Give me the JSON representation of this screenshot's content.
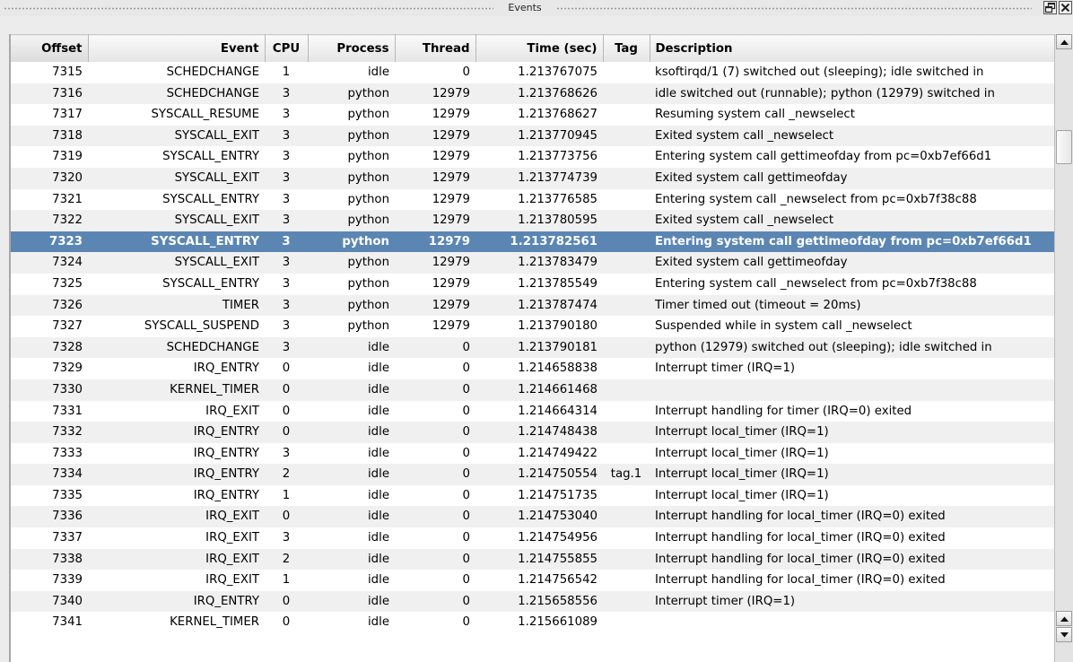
{
  "window": {
    "title": "Events"
  },
  "columns": [
    "Offset",
    "Event",
    "CPU",
    "Process",
    "Thread",
    "Time (sec)",
    "Tag",
    "Description"
  ],
  "selected_offset": "7323",
  "rows": [
    {
      "offset": "7315",
      "event": "SCHEDCHANGE",
      "cpu": "1",
      "process": "idle",
      "thread": "0",
      "time": "1.213767075",
      "tag": "",
      "desc": "ksoftirqd/1 (7) switched out (sleeping); idle switched in"
    },
    {
      "offset": "7316",
      "event": "SCHEDCHANGE",
      "cpu": "3",
      "process": "python",
      "thread": "12979",
      "time": "1.213768626",
      "tag": "",
      "desc": "idle switched out (runnable); python (12979) switched in"
    },
    {
      "offset": "7317",
      "event": "SYSCALL_RESUME",
      "cpu": "3",
      "process": "python",
      "thread": "12979",
      "time": "1.213768627",
      "tag": "",
      "desc": "Resuming system call _newselect"
    },
    {
      "offset": "7318",
      "event": "SYSCALL_EXIT",
      "cpu": "3",
      "process": "python",
      "thread": "12979",
      "time": "1.213770945",
      "tag": "",
      "desc": "Exited system call _newselect"
    },
    {
      "offset": "7319",
      "event": "SYSCALL_ENTRY",
      "cpu": "3",
      "process": "python",
      "thread": "12979",
      "time": "1.213773756",
      "tag": "",
      "desc": "Entering system call gettimeofday from pc=0xb7ef66d1"
    },
    {
      "offset": "7320",
      "event": "SYSCALL_EXIT",
      "cpu": "3",
      "process": "python",
      "thread": "12979",
      "time": "1.213774739",
      "tag": "",
      "desc": "Exited system call gettimeofday"
    },
    {
      "offset": "7321",
      "event": "SYSCALL_ENTRY",
      "cpu": "3",
      "process": "python",
      "thread": "12979",
      "time": "1.213776585",
      "tag": "",
      "desc": "Entering system call _newselect from pc=0xb7f38c88"
    },
    {
      "offset": "7322",
      "event": "SYSCALL_EXIT",
      "cpu": "3",
      "process": "python",
      "thread": "12979",
      "time": "1.213780595",
      "tag": "",
      "desc": "Exited system call _newselect"
    },
    {
      "offset": "7323",
      "event": "SYSCALL_ENTRY",
      "cpu": "3",
      "process": "python",
      "thread": "12979",
      "time": "1.213782561",
      "tag": "",
      "desc": "Entering system call gettimeofday from pc=0xb7ef66d1"
    },
    {
      "offset": "7324",
      "event": "SYSCALL_EXIT",
      "cpu": "3",
      "process": "python",
      "thread": "12979",
      "time": "1.213783479",
      "tag": "",
      "desc": "Exited system call gettimeofday"
    },
    {
      "offset": "7325",
      "event": "SYSCALL_ENTRY",
      "cpu": "3",
      "process": "python",
      "thread": "12979",
      "time": "1.213785549",
      "tag": "",
      "desc": "Entering system call _newselect from pc=0xb7f38c88"
    },
    {
      "offset": "7326",
      "event": "TIMER",
      "cpu": "3",
      "process": "python",
      "thread": "12979",
      "time": "1.213787474",
      "tag": "",
      "desc": "Timer timed out (timeout = 20ms)"
    },
    {
      "offset": "7327",
      "event": "SYSCALL_SUSPEND",
      "cpu": "3",
      "process": "python",
      "thread": "12979",
      "time": "1.213790180",
      "tag": "",
      "desc": "Suspended while in system call _newselect"
    },
    {
      "offset": "7328",
      "event": "SCHEDCHANGE",
      "cpu": "3",
      "process": "idle",
      "thread": "0",
      "time": "1.213790181",
      "tag": "",
      "desc": "python (12979) switched out (sleeping); idle switched in"
    },
    {
      "offset": "7329",
      "event": "IRQ_ENTRY",
      "cpu": "0",
      "process": "idle",
      "thread": "0",
      "time": "1.214658838",
      "tag": "",
      "desc": "Interrupt timer (IRQ=1)"
    },
    {
      "offset": "7330",
      "event": "KERNEL_TIMER",
      "cpu": "0",
      "process": "idle",
      "thread": "0",
      "time": "1.214661468",
      "tag": "",
      "desc": ""
    },
    {
      "offset": "7331",
      "event": "IRQ_EXIT",
      "cpu": "0",
      "process": "idle",
      "thread": "0",
      "time": "1.214664314",
      "tag": "",
      "desc": "Interrupt handling for timer (IRQ=0) exited"
    },
    {
      "offset": "7332",
      "event": "IRQ_ENTRY",
      "cpu": "0",
      "process": "idle",
      "thread": "0",
      "time": "1.214748438",
      "tag": "",
      "desc": "Interrupt local_timer (IRQ=1)"
    },
    {
      "offset": "7333",
      "event": "IRQ_ENTRY",
      "cpu": "3",
      "process": "idle",
      "thread": "0",
      "time": "1.214749422",
      "tag": "",
      "desc": "Interrupt local_timer (IRQ=1)"
    },
    {
      "offset": "7334",
      "event": "IRQ_ENTRY",
      "cpu": "2",
      "process": "idle",
      "thread": "0",
      "time": "1.214750554",
      "tag": "tag.1",
      "desc": "Interrupt local_timer (IRQ=1)"
    },
    {
      "offset": "7335",
      "event": "IRQ_ENTRY",
      "cpu": "1",
      "process": "idle",
      "thread": "0",
      "time": "1.214751735",
      "tag": "",
      "desc": "Interrupt local_timer (IRQ=1)"
    },
    {
      "offset": "7336",
      "event": "IRQ_EXIT",
      "cpu": "0",
      "process": "idle",
      "thread": "0",
      "time": "1.214753040",
      "tag": "",
      "desc": "Interrupt handling for local_timer (IRQ=0) exited"
    },
    {
      "offset": "7337",
      "event": "IRQ_EXIT",
      "cpu": "3",
      "process": "idle",
      "thread": "0",
      "time": "1.214754956",
      "tag": "",
      "desc": "Interrupt handling for local_timer (IRQ=0) exited"
    },
    {
      "offset": "7338",
      "event": "IRQ_EXIT",
      "cpu": "2",
      "process": "idle",
      "thread": "0",
      "time": "1.214755855",
      "tag": "",
      "desc": "Interrupt handling for local_timer (IRQ=0) exited"
    },
    {
      "offset": "7339",
      "event": "IRQ_EXIT",
      "cpu": "1",
      "process": "idle",
      "thread": "0",
      "time": "1.214756542",
      "tag": "",
      "desc": "Interrupt handling for local_timer (IRQ=0) exited"
    },
    {
      "offset": "7340",
      "event": "IRQ_ENTRY",
      "cpu": "0",
      "process": "idle",
      "thread": "0",
      "time": "1.215658556",
      "tag": "",
      "desc": "Interrupt timer (IRQ=1)"
    },
    {
      "offset": "7341",
      "event": "KERNEL_TIMER",
      "cpu": "0",
      "process": "idle",
      "thread": "0",
      "time": "1.215661089",
      "tag": "",
      "desc": ""
    }
  ],
  "icons": {
    "float": "float-window-icon",
    "close": "close-icon",
    "scroll_up": "arrow-up-icon",
    "scroll_down": "arrow-down-icon"
  },
  "colors": {
    "selection": "#5b86b3",
    "row_alt": "#f0f0f0",
    "header": "#e4e4e4"
  }
}
